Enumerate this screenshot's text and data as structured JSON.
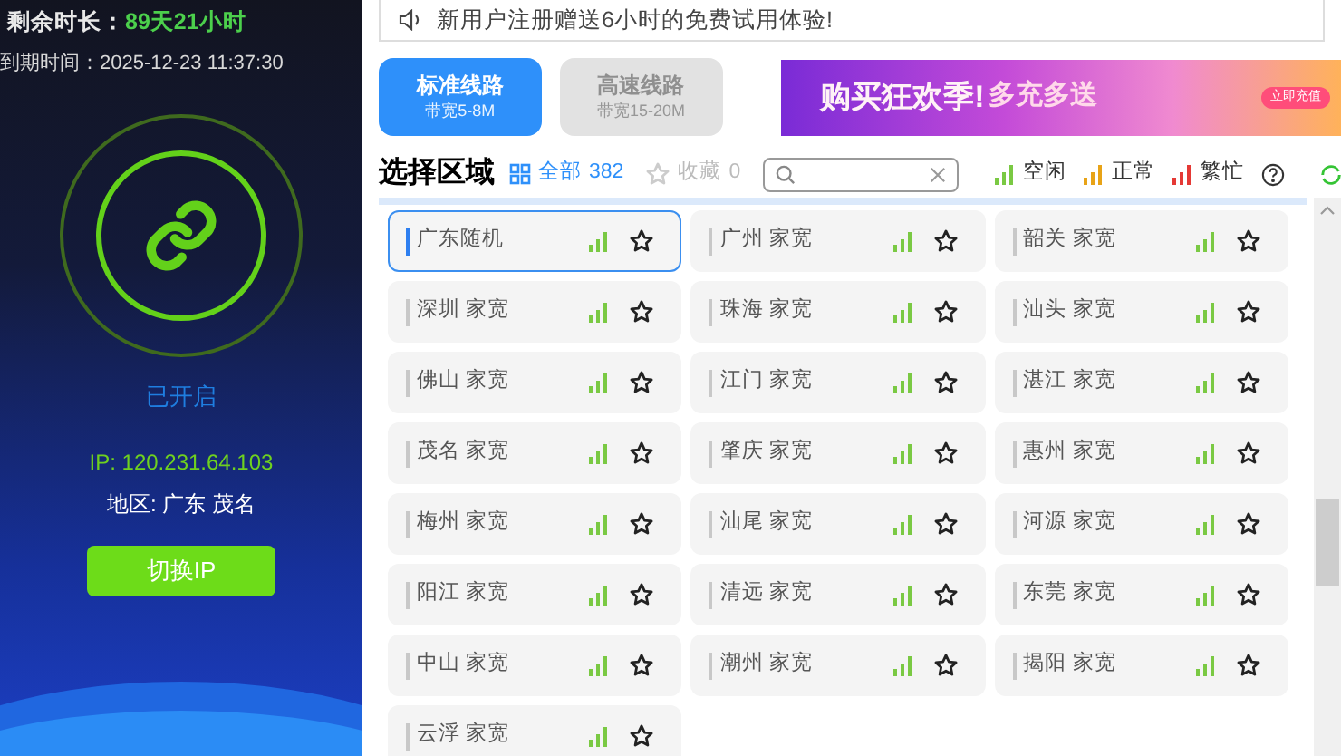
{
  "account": {
    "remaining_label": "剩余时长：",
    "remaining_value": "89天21小时",
    "expiry_label": "到期时间：",
    "expiry_value": "2025-12-23 11:37:30"
  },
  "connection": {
    "on": true,
    "status": "已开启",
    "ip": "IP: 120.231.64.103",
    "region": "地区: 广东 茂名",
    "switch_button": "切换IP"
  },
  "notice": "新用户注册赠送6小时的免费试用体验!",
  "lines": [
    {
      "title": "标准线路",
      "subtitle": "带宽5-8M",
      "selected": true
    },
    {
      "title": "高速线路",
      "subtitle": "带宽15-20M",
      "selected": false
    }
  ],
  "banner": {
    "headline": "购买狂欢季!",
    "tagline": "多充多送",
    "button": "立即充值"
  },
  "region_panel": {
    "title": "选择区域",
    "filters": [
      {
        "kind": "all",
        "label": "全部",
        "count": "382",
        "selected": true
      },
      {
        "kind": "favorites",
        "label": "收藏",
        "count": "0",
        "selected": false
      }
    ],
    "legend": [
      {
        "label": "空闲",
        "color": "#7ac943"
      },
      {
        "label": "正常",
        "color": "#e8a317"
      },
      {
        "label": "繁忙",
        "color": "#e53935"
      }
    ]
  },
  "regions": [
    {
      "name": "广东随机",
      "selected": true
    },
    {
      "name": "广州 家宽",
      "selected": false
    },
    {
      "name": "韶关 家宽",
      "selected": false
    },
    {
      "name": "深圳 家宽",
      "selected": false
    },
    {
      "name": "珠海 家宽",
      "selected": false
    },
    {
      "name": "汕头 家宽",
      "selected": false
    },
    {
      "name": "佛山 家宽",
      "selected": false
    },
    {
      "name": "江门 家宽",
      "selected": false
    },
    {
      "name": "湛江 家宽",
      "selected": false
    },
    {
      "name": "茂名 家宽",
      "selected": false
    },
    {
      "name": "肇庆 家宽",
      "selected": false
    },
    {
      "name": "惠州 家宽",
      "selected": false
    },
    {
      "name": "梅州 家宽",
      "selected": false
    },
    {
      "name": "汕尾 家宽",
      "selected": false
    },
    {
      "name": "河源 家宽",
      "selected": false
    },
    {
      "name": "阳江 家宽",
      "selected": false
    },
    {
      "name": "清远 家宽",
      "selected": false
    },
    {
      "name": "东莞 家宽",
      "selected": false
    },
    {
      "name": "中山 家宽",
      "selected": false
    },
    {
      "name": "潮州 家宽",
      "selected": false
    },
    {
      "name": "揭阳 家宽",
      "selected": false
    },
    {
      "name": "云浮 家宽",
      "selected": false
    }
  ]
}
